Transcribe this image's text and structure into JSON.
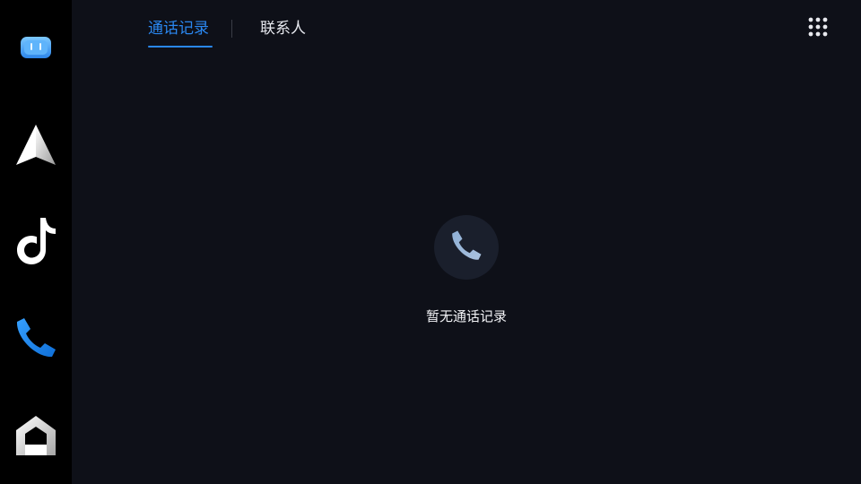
{
  "sidebar": {
    "items": [
      {
        "icon": "assistant-robot-icon",
        "accent": "#4aa8f5"
      },
      {
        "icon": "navigation-arrow-icon",
        "accent": "#ffffff"
      },
      {
        "icon": "music-note-icon",
        "accent": "#ffffff"
      },
      {
        "icon": "phone-icon",
        "accent": "#1e88f2",
        "active": true
      },
      {
        "icon": "home-icon",
        "accent": "#ffffff"
      }
    ]
  },
  "header": {
    "tabs": [
      {
        "label": "通话记录",
        "active": true
      },
      {
        "label": "联系人",
        "active": false
      }
    ],
    "menu_icon": "grid-menu-icon",
    "accent_color": "#2a87f0"
  },
  "main": {
    "empty_state": {
      "icon": "phone-icon",
      "message": "暂无通话记录"
    }
  }
}
